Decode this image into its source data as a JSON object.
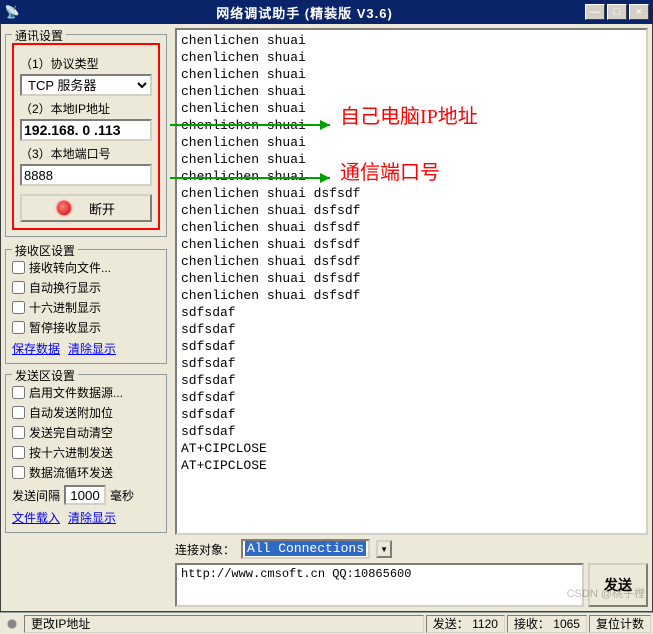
{
  "window": {
    "title": "网络调试助手 (精装版 V3.6)"
  },
  "comm": {
    "legend": "通讯设置",
    "p1_label": "（1）协议类型",
    "protocol": "TCP 服务器",
    "p2_label": "（2）本地IP地址",
    "ip": "192.168. 0 .113",
    "p3_label": "（3）本地端口号",
    "port": "8888",
    "disconnect": "断开"
  },
  "rx": {
    "legend": "接收区设置",
    "c1": "接收转向文件...",
    "c2": "自动换行显示",
    "c3": "十六进制显示",
    "c4": "暂停接收显示",
    "save": "保存数据",
    "clear": "清除显示"
  },
  "tx": {
    "legend": "发送区设置",
    "c1": "启用文件数据源...",
    "c2": "自动发送附加位",
    "c3": "发送完自动清空",
    "c4": "按十六进制发送",
    "c5": "数据流循环发送",
    "interval_label": "发送间隔",
    "interval_val": "1000",
    "interval_unit": "毫秒",
    "fileload": "文件载入",
    "clear": "清除显示"
  },
  "log_lines": [
    "chenlichen shuai",
    "chenlichen shuai",
    "chenlichen shuai",
    "chenlichen shuai",
    "chenlichen shuai",
    "chenlichen shuai",
    "chenlichen shuai",
    "chenlichen shuai",
    "chenlichen shuai",
    "chenlichen shuai dsfsdf",
    "chenlichen shuai dsfsdf",
    "chenlichen shuai dsfsdf",
    "chenlichen shuai dsfsdf",
    "chenlichen shuai dsfsdf",
    "chenlichen shuai dsfsdf",
    "chenlichen shuai dsfsdf",
    "sdfsdaf",
    "sdfsdaf",
    "sdfsdaf",
    "sdfsdaf",
    "sdfsdaf",
    "sdfsdaf",
    "sdfsdaf",
    "sdfsdaf",
    "AT+CIPCLOSE",
    "AT+CIPCLOSE"
  ],
  "conn": {
    "label": "连接对象：",
    "value": "All Connections"
  },
  "sendbox": {
    "value": "http://www.cmsoft.cn QQ:10865600",
    "btn": "发送"
  },
  "status": {
    "changeip": "更改IP地址",
    "sent_label": "发送：",
    "sent_val": "1120",
    "recv_label": "接收：",
    "recv_val": "1065",
    "reset": "复位计数"
  },
  "anno": {
    "a1": "自己电脑IP地址",
    "a2": "通信端口号"
  },
  "watermark": "CSDN @桃子樘"
}
